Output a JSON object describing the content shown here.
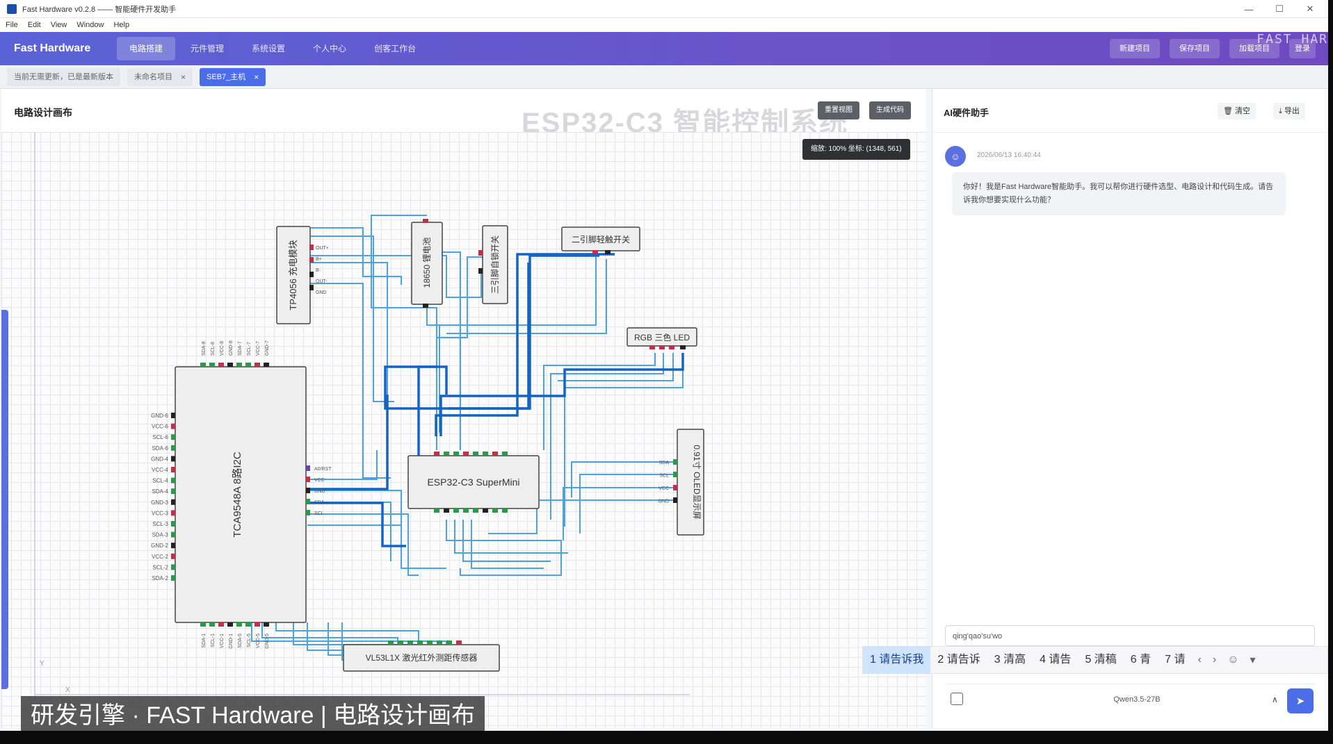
{
  "window": {
    "title": "Fast Hardware v0.2.8 —— 智能硬件开发助手",
    "minimize_icon": "minimize-icon",
    "maximize_icon": "maximize-icon",
    "close_icon": "close-icon"
  },
  "menu": {
    "items": [
      "File",
      "Edit",
      "View",
      "Window",
      "Help"
    ]
  },
  "nav": {
    "brand": "Fast Hardware",
    "tabs": [
      "电路搭建",
      "元件管理",
      "系统设置",
      "个人中心",
      "创客工作台"
    ],
    "active_tab": 0,
    "header_buttons": [
      "新建项目",
      "保存项目",
      "加载项目",
      "登录"
    ],
    "watermark": "FAST HAR"
  },
  "doc_tabs": {
    "info": "当前无需更新，已是最新版本",
    "tabs": [
      {
        "label": "未命名项目",
        "closable": true,
        "active": false
      },
      {
        "label": "SEB7_主机",
        "closable": true,
        "active": true
      }
    ],
    "close_glyph": "×"
  },
  "canvas": {
    "title": "电路设计画布",
    "system_title": "ESP32-C3 智能控制系统",
    "btn_reset": "重置视图",
    "btn_code": "生成代码",
    "zoom_info": "缩放: 100% 坐标: (1348, 561)",
    "axis_x": "X",
    "axis_y": "Y",
    "components": {
      "tp4056": "TP4056 充电模块",
      "battery": "18650 锂电池",
      "switch3": "三引脚自锁开关",
      "switch2": "二引脚轻触开关",
      "rgb": "RGB 三色 LED",
      "tca": "TCA9548A 8路I2C",
      "esp32": "ESP32-C3 SuperMini",
      "oled": "0.91寸 OLED显示屏",
      "vl53": "VL53L1X 激光红外测距传感器"
    },
    "tca_left_pins": [
      "GND-6",
      "VCC-6",
      "SCL-6",
      "SDA-6",
      "GND-4",
      "VCC-4",
      "SCL-4",
      "SDA-4",
      "GND-3",
      "VCC-3",
      "SCL-3",
      "SDA-3",
      "GND-2",
      "VCC-2",
      "SCL-2",
      "SDA-2"
    ],
    "tca_top_pins": [
      "SDA-8",
      "SCL-8",
      "VCC-8",
      "GND-8",
      "SDA-7",
      "SCL-7",
      "VCC-7",
      "GND-7"
    ],
    "tca_bottom_pins": [
      "SDA-1",
      "SCL-1",
      "VCC-1",
      "GND-1",
      "SDA-5",
      "SCL-5",
      "VCC-5",
      "GND-5"
    ],
    "tca_right_pins": [
      "A0/RST",
      "VCC",
      "GND",
      "SDA",
      "SCL"
    ],
    "oled_pins": [
      "SDA",
      "SCL",
      "VCC",
      "GND"
    ],
    "tp4056_pins": [
      "OUT+",
      "B+",
      "B-",
      "OUT-",
      "GND"
    ]
  },
  "ai": {
    "title": "AI硬件助手",
    "btn_clear": "清空",
    "btn_export": "导出",
    "clear_icon": "trash-icon",
    "export_icon": "download-icon",
    "message_time": "2026/06/13 16:40:44",
    "message_text": "你好！我是Fast Hardware智能助手。我可以帮你进行硬件选型、电路设计和代码生成。请告诉我你想要实现什么功能？",
    "input_value": "qing'qao'su'wo",
    "model": "Qwen3.5-27B",
    "model_chevron": "∧",
    "send_icon": "send-icon",
    "attach_icon": "image-icon"
  },
  "ime": {
    "candidates": [
      "1 请告诉我",
      "2 请告诉",
      "3 清高",
      "4 请告",
      "5 清稿",
      "6 青",
      "7 请"
    ],
    "selected": 0,
    "prev": "‹",
    "next": "›",
    "emoji_icon": "smiley-icon",
    "menu": "▾"
  },
  "caption": "研发引擎 · FAST Hardware | 电路设计画布",
  "colors": {
    "nav_start": "#5a63d6",
    "nav_end": "#6e49c0",
    "accent": "#4b6ee8",
    "wire_dark": "#1565c0",
    "wire_light": "#4aa3df"
  }
}
